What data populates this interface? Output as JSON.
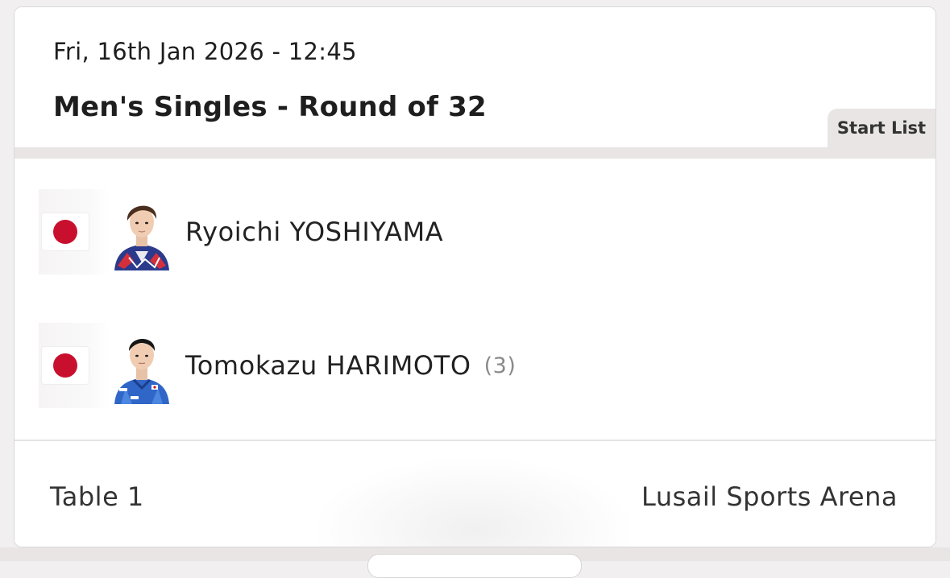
{
  "match": {
    "datetime": "Fri, 16th Jan 2026 - 12:45",
    "event": "Men's Singles - Round of 32",
    "tab_label": "Start List"
  },
  "players": [
    {
      "name": "Ryoichi YOSHIYAMA",
      "country_flag": "japan-flag",
      "seed": ""
    },
    {
      "name": "Tomokazu HARIMOTO",
      "country_flag": "japan-flag",
      "seed": "(3)"
    }
  ],
  "footer": {
    "table": "Table 1",
    "venue": "Lusail Sports Arena"
  },
  "colors": {
    "flag_red": "#c8102e",
    "tab_bg": "#e9e5e4",
    "text_dark": "#1e1e1e",
    "seed_gray": "#8a8a8a"
  }
}
